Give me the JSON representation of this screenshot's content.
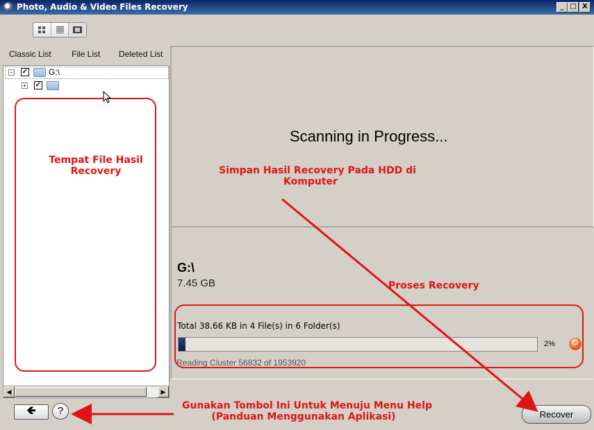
{
  "window": {
    "title": "Photo, Audio & Video Files Recovery",
    "controls": [
      "_",
      "□",
      "X"
    ]
  },
  "toolbar": {
    "view_buttons": [
      "grid-view-icon",
      "list-view-icon",
      "filmstrip-view-icon"
    ]
  },
  "left_tabs": [
    "Classic List",
    "File List",
    "Deleted List"
  ],
  "tree": {
    "root_label": "G:\\"
  },
  "scan": {
    "status": "Scanning in Progress..."
  },
  "drive": {
    "name": "G:\\",
    "size": "7.45 GB"
  },
  "progress": {
    "total_text": "Total 38.66 KB in 4 File(s) in 6 Folder(s)",
    "percent_label": "2%",
    "percent": 2,
    "reading_text": "Reading Cluster 56832  of  1953920"
  },
  "buttons": {
    "back_icon": "back-arrow-icon",
    "help_label": "?",
    "recover_label": "Recover"
  },
  "annotations": {
    "tempat_line1": "Tempat File Hasil",
    "tempat_line2": "Recovery",
    "simpan_line1": "Simpan Hasil Recovery Pada HDD di",
    "simpan_line2": "Komputer",
    "proses": "Proses Recovery",
    "help_line1": "Gunakan Tombol Ini Untuk Menuju Menu Help",
    "help_line2": "(Panduan Menggunakan Aplikasi)",
    "color": "#e01414"
  }
}
